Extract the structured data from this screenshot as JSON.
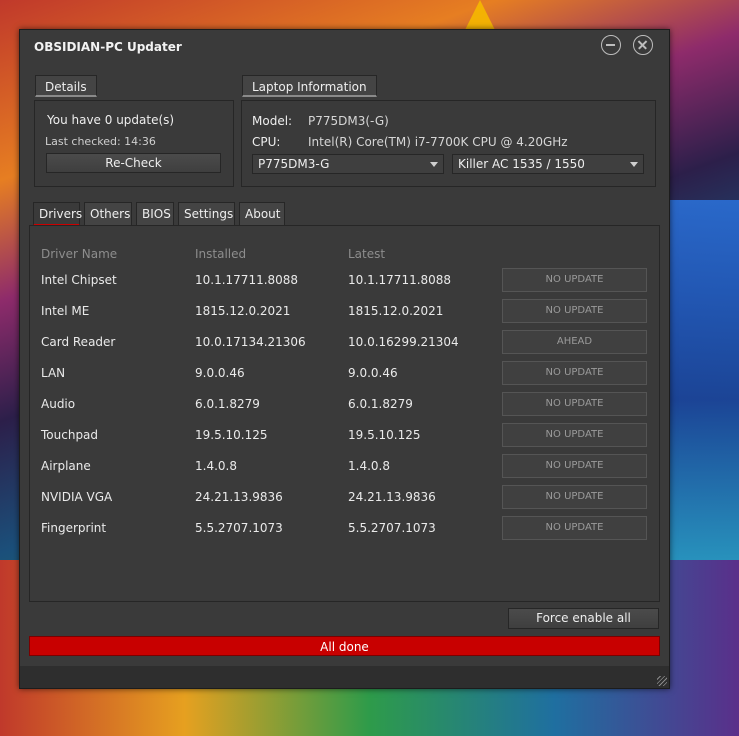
{
  "window": {
    "title": "OBSIDIAN-PC Updater"
  },
  "details": {
    "tab_label": "Details",
    "updates_text": "You have 0 update(s)",
    "last_checked": "Last checked: 14:36",
    "recheck_label": "Re-Check"
  },
  "laptop": {
    "tab_label": "Laptop Information",
    "model_label": "Model:",
    "model_value": "P775DM3(-G)",
    "cpu_label": "CPU:",
    "cpu_value": "Intel(R) Core(TM) i7-7700K CPU @ 4.20GHz",
    "model_select": "P775DM3-G",
    "wifi_select": "Killer AC 1535 / 1550"
  },
  "tabs": [
    "Drivers",
    "Others",
    "BIOS",
    "Settings",
    "About"
  ],
  "drivers": {
    "headers": {
      "name": "Driver Name",
      "installed": "Installed",
      "latest": "Latest"
    },
    "rows": [
      {
        "name": "Intel Chipset",
        "installed": "10.1.17711.8088",
        "latest": "10.1.17711.8088",
        "status": "NO UPDATE"
      },
      {
        "name": "Intel ME",
        "installed": "1815.12.0.2021",
        "latest": "1815.12.0.2021",
        "status": "NO UPDATE"
      },
      {
        "name": "Card Reader",
        "installed": "10.0.17134.21306",
        "latest": "10.0.16299.21304",
        "status": "AHEAD"
      },
      {
        "name": "LAN",
        "installed": "9.0.0.46",
        "latest": "9.0.0.46",
        "status": "NO UPDATE"
      },
      {
        "name": "Audio",
        "installed": "6.0.1.8279",
        "latest": "6.0.1.8279",
        "status": "NO UPDATE"
      },
      {
        "name": "Touchpad",
        "installed": "19.5.10.125",
        "latest": "19.5.10.125",
        "status": "NO UPDATE"
      },
      {
        "name": "Airplane",
        "installed": "1.4.0.8",
        "latest": "1.4.0.8",
        "status": "NO UPDATE"
      },
      {
        "name": "NVIDIA VGA",
        "installed": "24.21.13.9836",
        "latest": "24.21.13.9836",
        "status": "NO UPDATE"
      },
      {
        "name": "Fingerprint",
        "installed": "5.5.2707.1073",
        "latest": "5.5.2707.1073",
        "status": "NO UPDATE"
      }
    ]
  },
  "force_enable_label": "Force enable all",
  "status_text": "All done",
  "colors": {
    "accent": "#c80000",
    "window_bg": "#3a3a3a"
  }
}
